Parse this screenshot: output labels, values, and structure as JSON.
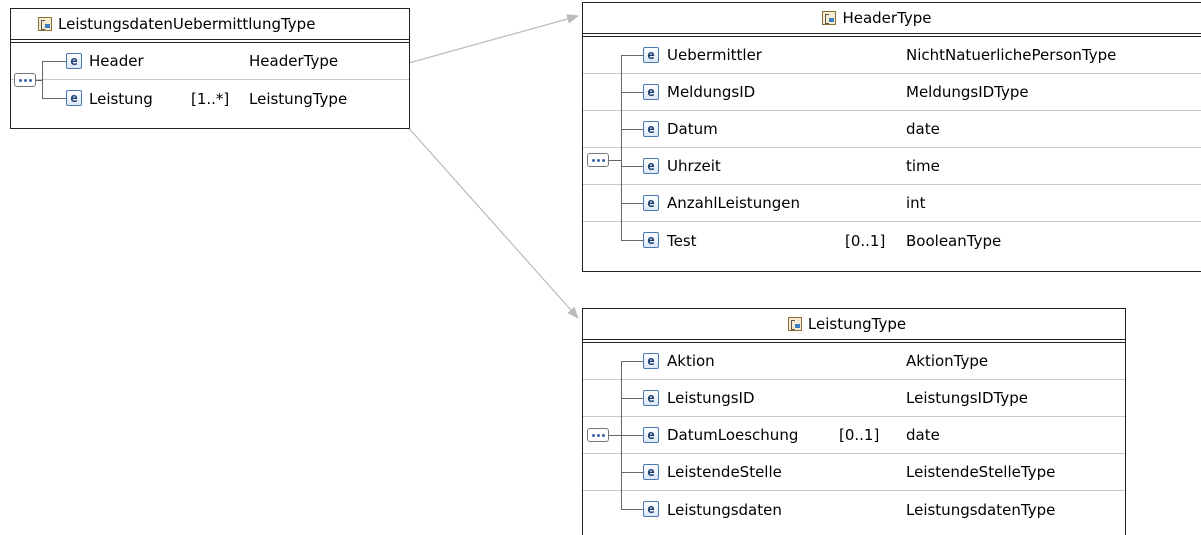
{
  "icons": {
    "element": "e",
    "element_icon": "element-e-icon",
    "complex_type_icon": "complex-type-icon",
    "sequence_icon": "sequence-compositor-icon"
  },
  "colors": {
    "border": "#222222",
    "row_divider": "#c8c8c8",
    "connector": "#bbbbbb",
    "element_icon_border": "#4a78b0"
  },
  "leistungsdaten_uebermittlung": {
    "title": "LeistungsdatenUebermittlungType",
    "elements": [
      {
        "name": "Header",
        "multiplicity": "",
        "type": "HeaderType"
      },
      {
        "name": "Leistung",
        "multiplicity": "[1..*]",
        "type": "LeistungType"
      }
    ]
  },
  "header_type": {
    "title": "HeaderType",
    "elements": [
      {
        "name": "Uebermittler",
        "multiplicity": "",
        "type": "NichtNatuerlichePersonType"
      },
      {
        "name": "MeldungsID",
        "multiplicity": "",
        "type": "MeldungsIDType"
      },
      {
        "name": "Datum",
        "multiplicity": "",
        "type": "date"
      },
      {
        "name": "Uhrzeit",
        "multiplicity": "",
        "type": "time"
      },
      {
        "name": "AnzahlLeistungen",
        "multiplicity": "",
        "type": "int"
      },
      {
        "name": "Test",
        "multiplicity": "[0..1]",
        "type": "BooleanType"
      }
    ]
  },
  "leistung_type": {
    "title": "LeistungType",
    "elements": [
      {
        "name": "Aktion",
        "multiplicity": "",
        "type": "AktionType"
      },
      {
        "name": "LeistungsID",
        "multiplicity": "",
        "type": "LeistungsIDType"
      },
      {
        "name": "DatumLoeschung",
        "multiplicity": "[0..1]",
        "type": "date"
      },
      {
        "name": "LeistendeStelle",
        "multiplicity": "",
        "type": "LeistendeStelleType"
      },
      {
        "name": "Leistungsdaten",
        "multiplicity": "",
        "type": "LeistungsdatenType"
      }
    ]
  }
}
